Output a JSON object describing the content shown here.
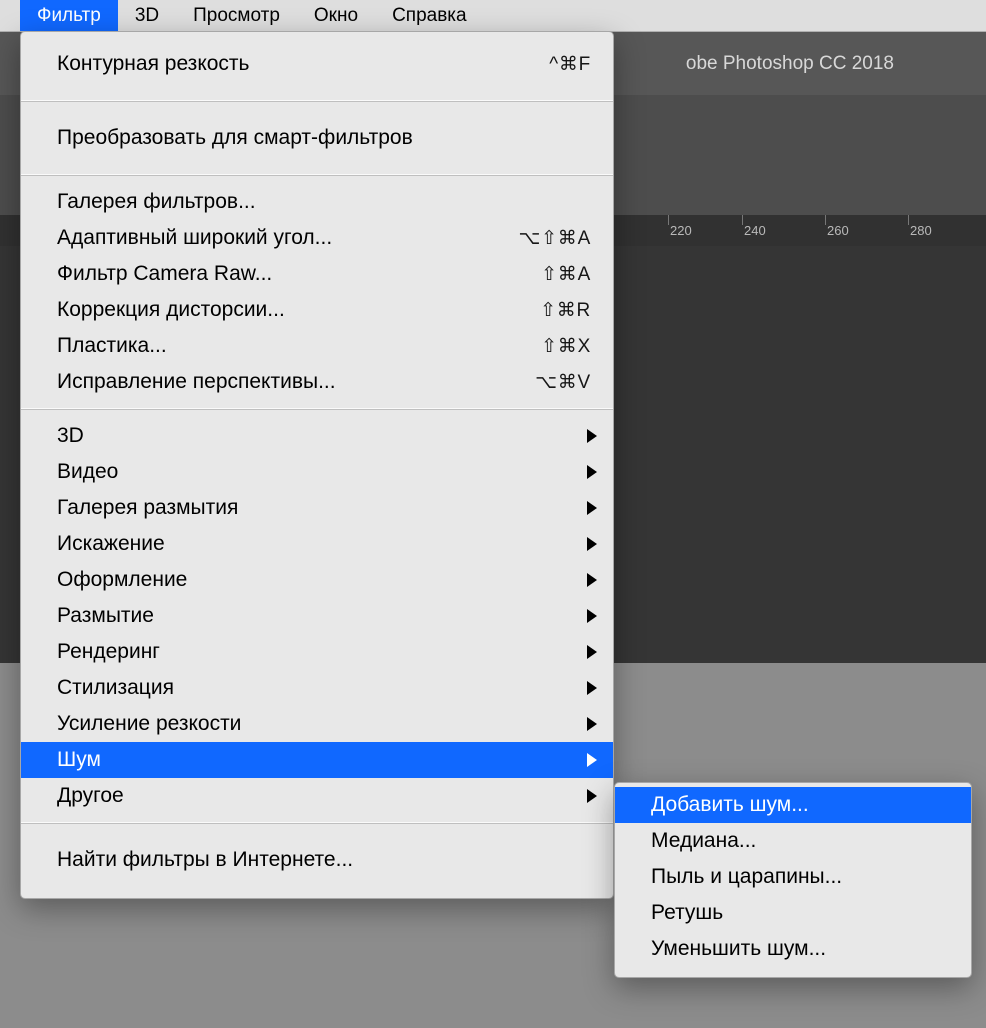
{
  "menubar": {
    "items": [
      {
        "label": "Фильтр",
        "active": true
      },
      {
        "label": "3D"
      },
      {
        "label": "Просмотр"
      },
      {
        "label": "Окно"
      },
      {
        "label": "Справка"
      }
    ]
  },
  "titlebar": {
    "text": "obe Photoshop CC 2018"
  },
  "ruler": {
    "ticks": [
      "220",
      "240",
      "260",
      "280"
    ]
  },
  "filter_menu": {
    "last_filter": {
      "label": "Контурная резкость",
      "shortcut": "^⌘F"
    },
    "convert": {
      "label": "Преобразовать для смарт-фильтров"
    },
    "gallery": {
      "label": "Галерея фильтров..."
    },
    "adaptive_wide": {
      "label": "Адаптивный широкий угол...",
      "shortcut": "⌥⇧⌘A"
    },
    "camera_raw": {
      "label": "Фильтр Camera Raw...",
      "shortcut": "⇧⌘A"
    },
    "lens_correction": {
      "label": "Коррекция дисторсии...",
      "shortcut": "⇧⌘R"
    },
    "liquify": {
      "label": "Пластика...",
      "shortcut": "⇧⌘X"
    },
    "vanishing_point": {
      "label": "Исправление перспективы...",
      "shortcut": "⌥⌘V"
    },
    "sub_3d": {
      "label": "3D"
    },
    "sub_video": {
      "label": "Видео"
    },
    "sub_blur_gallery": {
      "label": "Галерея размытия"
    },
    "sub_distort": {
      "label": "Искажение"
    },
    "sub_pixelate": {
      "label": "Оформление"
    },
    "sub_blur": {
      "label": "Размытие"
    },
    "sub_render": {
      "label": "Рендеринг"
    },
    "sub_stylize": {
      "label": "Стилизация"
    },
    "sub_sharpen": {
      "label": "Усиление резкости"
    },
    "sub_noise": {
      "label": "Шум"
    },
    "sub_other": {
      "label": "Другое"
    },
    "browse_online": {
      "label": "Найти фильтры в Интернете..."
    }
  },
  "noise_submenu": {
    "add_noise": {
      "label": "Добавить шум..."
    },
    "median": {
      "label": "Медиана..."
    },
    "dust_scratches": {
      "label": "Пыль и царапины..."
    },
    "despeckle": {
      "label": "Ретушь"
    },
    "reduce_noise": {
      "label": "Уменьшить шум..."
    }
  }
}
